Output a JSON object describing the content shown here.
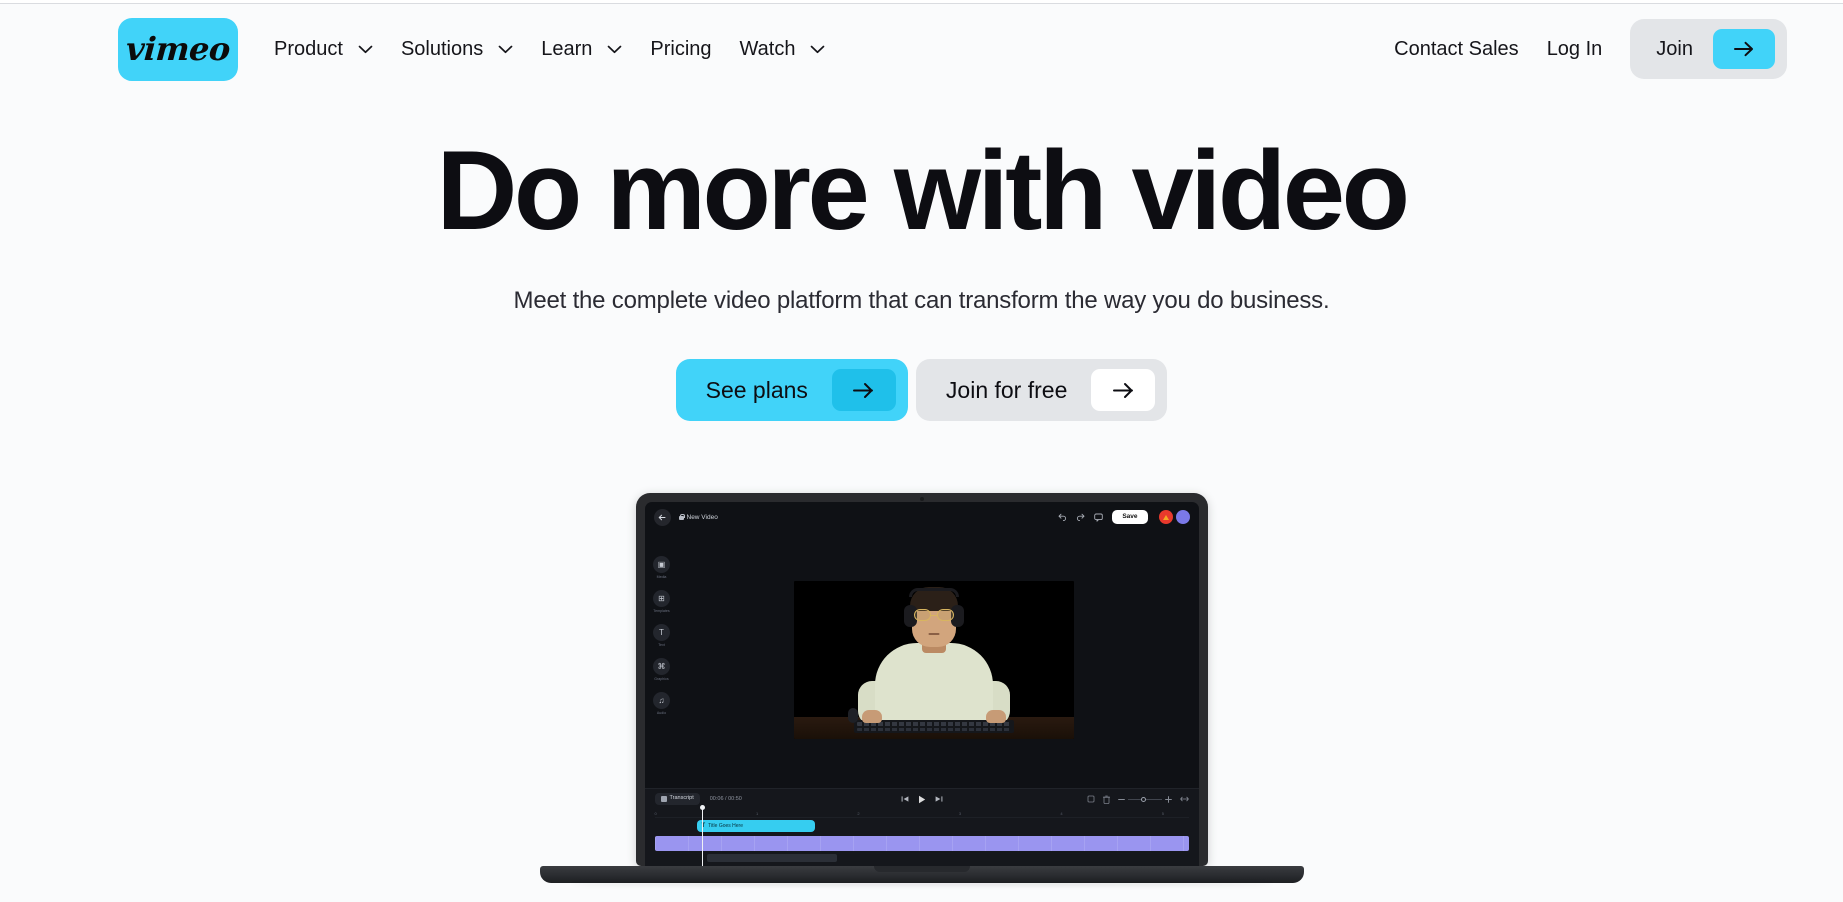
{
  "brand": {
    "logo_text": "vimeo",
    "accent_cyan": "#41d3f9",
    "accent_cyan_dark": "#1fc0ea",
    "neutral_gray": "#e3e5e8",
    "text_dark": "#0d0d12",
    "page_bg": "#fafbfc"
  },
  "header": {
    "nav_items": [
      {
        "label": "Product",
        "has_chevron": true,
        "icon": "chevron-down-icon"
      },
      {
        "label": "Solutions",
        "has_chevron": true,
        "icon": "chevron-down-icon"
      },
      {
        "label": "Learn",
        "has_chevron": true,
        "icon": "chevron-down-icon"
      },
      {
        "label": "Pricing",
        "has_chevron": false,
        "icon": ""
      },
      {
        "label": "Watch",
        "has_chevron": true,
        "icon": "chevron-down-icon"
      }
    ],
    "contact_sales": "Contact Sales",
    "log_in": "Log In",
    "join": "Join",
    "join_arrow_icon": "arrow-right-icon"
  },
  "hero": {
    "title": "Do more with video",
    "subtitle": "Meet the complete video platform that can transform the way you do business.",
    "cta_primary": {
      "label": "See plans",
      "icon": "arrow-right-icon"
    },
    "cta_secondary": {
      "label": "Join for free",
      "icon": "arrow-right-icon"
    }
  },
  "editor": {
    "back_icon": "arrow-left-icon",
    "lock_icon": "lock-icon",
    "project_title": "New Video",
    "undo_icon": "undo-icon",
    "redo_icon": "redo-icon",
    "comment_icon": "comment-icon",
    "save_label": "Save",
    "avatars": [
      "avatar-red",
      "avatar-purple"
    ],
    "sidebar": [
      {
        "label": "Media",
        "icon": "media-icon",
        "glyph": "▣"
      },
      {
        "label": "Templates",
        "icon": "templates-icon",
        "glyph": "⊞"
      },
      {
        "label": "Text",
        "icon": "text-icon",
        "glyph": "T"
      },
      {
        "label": "Graphics",
        "icon": "graphics-icon",
        "glyph": "⌘"
      },
      {
        "label": "Audio",
        "icon": "music-icon",
        "glyph": "♫"
      }
    ],
    "timeline": {
      "transcript_label": "Transcript",
      "timecode": "00:06 / 00:50",
      "prev_icon": "skip-back-icon",
      "play_icon": "play-icon",
      "next_icon": "skip-forward-icon",
      "crop_icon": "crop-icon",
      "delete_icon": "trash-icon",
      "zoom_out_icon": "minus-icon",
      "zoom_in_icon": "plus-icon",
      "fit_icon": "fit-icon",
      "ruler_ticks": [
        "0",
        "1",
        "2",
        "3",
        "4",
        "5"
      ],
      "text_clip": {
        "badge": "T",
        "label": "Title Goes Here"
      }
    }
  }
}
